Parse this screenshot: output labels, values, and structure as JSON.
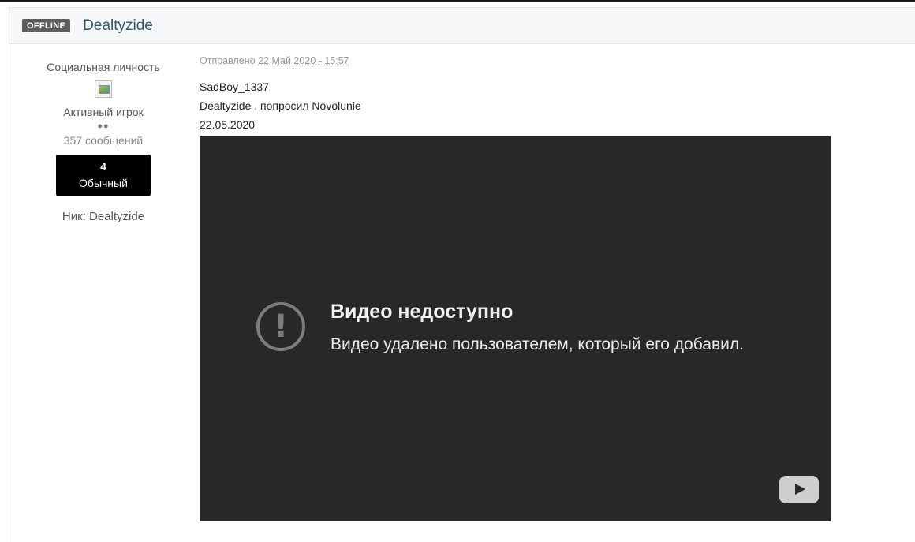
{
  "post": {
    "status_badge": "OFFLINE",
    "author_name": "Dealtyzide",
    "author": {
      "user_title": "Социальная личность",
      "avatar_icon": "broken-image-icon",
      "rank_name": "Активный игрок",
      "rank_pips": "●●",
      "post_count": "357 сообщений",
      "reputation": {
        "value": "4",
        "label": "Обычный"
      },
      "nick_line": "Ник: Dealtyzide"
    },
    "posted_prefix": "Отправлено",
    "posted_date": "22 Май 2020 - 15:57",
    "body_lines": [
      "SadBoy_1337",
      "Dealtyzide , попросил Novolunie",
      "22.05.2020"
    ],
    "video": {
      "icon": "exclamation-circle-icon",
      "title": "Видео недоступно",
      "message": "Видео удалено пользователем, который его добавил.",
      "logo_icon": "youtube-play-icon",
      "background_color": "#282828"
    }
  }
}
